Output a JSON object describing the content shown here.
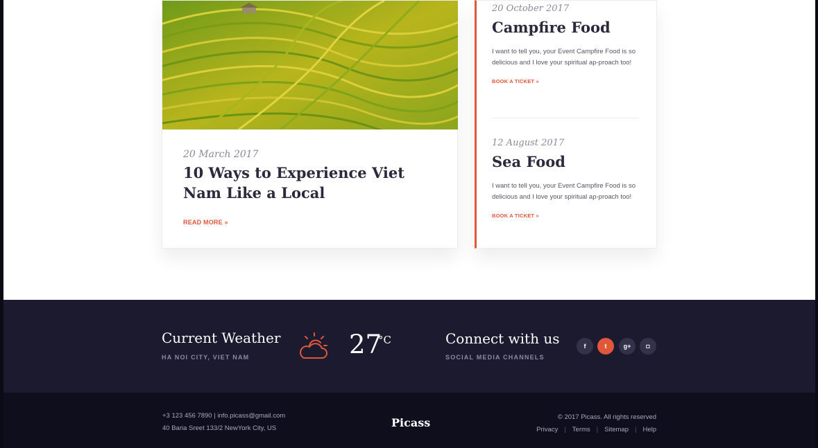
{
  "blog": {
    "main_post": {
      "date": "20 March 2017",
      "title": "10 Ways to Experience Viet Nam Like a Local",
      "read_more": "READ MORE »"
    },
    "events": [
      {
        "date": "20 October 2017",
        "name": "Campfire Food",
        "description": "I want to tell you, your Event Campfire Food is so delicious and I love your spiritual ap-proach too!",
        "cta": "BOOK A TICKET »"
      },
      {
        "date": "12 August 2017",
        "name": "Sea Food",
        "description": "I want to tell you, your Event Campfire Food is so delicious and I love your spiritual ap-proach too!",
        "cta": "BOOK A TICKET »"
      }
    ]
  },
  "weather": {
    "title": "Current Weather",
    "location": "HA NOI CITY, VIET NAM",
    "icon": "partly-cloudy-sun-icon",
    "temperature": "27",
    "unit": "°C"
  },
  "social": {
    "title": "Connect with us",
    "subtitle": "SOCIAL MEDIA CHANNELS",
    "channels": [
      {
        "name": "facebook-icon",
        "glyph": "f"
      },
      {
        "name": "twitter-icon",
        "glyph": "t"
      },
      {
        "name": "google-plus-icon",
        "glyph": "g+"
      },
      {
        "name": "instagram-icon",
        "glyph": "◘"
      }
    ]
  },
  "footer": {
    "contact_line": "+3 123 456 7890 | info.picass@gmail.com",
    "address": "40 Baria Sreet 133/2 NewYork City, US",
    "brand": "Picass",
    "copyright": "© 2017 Picass. All rights reserved",
    "links": [
      "Privacy",
      "Terms",
      "Sitemap",
      "Help"
    ]
  },
  "colors": {
    "accent": "#e0573a",
    "footer_top": "#1c1a2e",
    "footer_bottom": "#0f0e1c",
    "heading": "#2b2a3d"
  }
}
